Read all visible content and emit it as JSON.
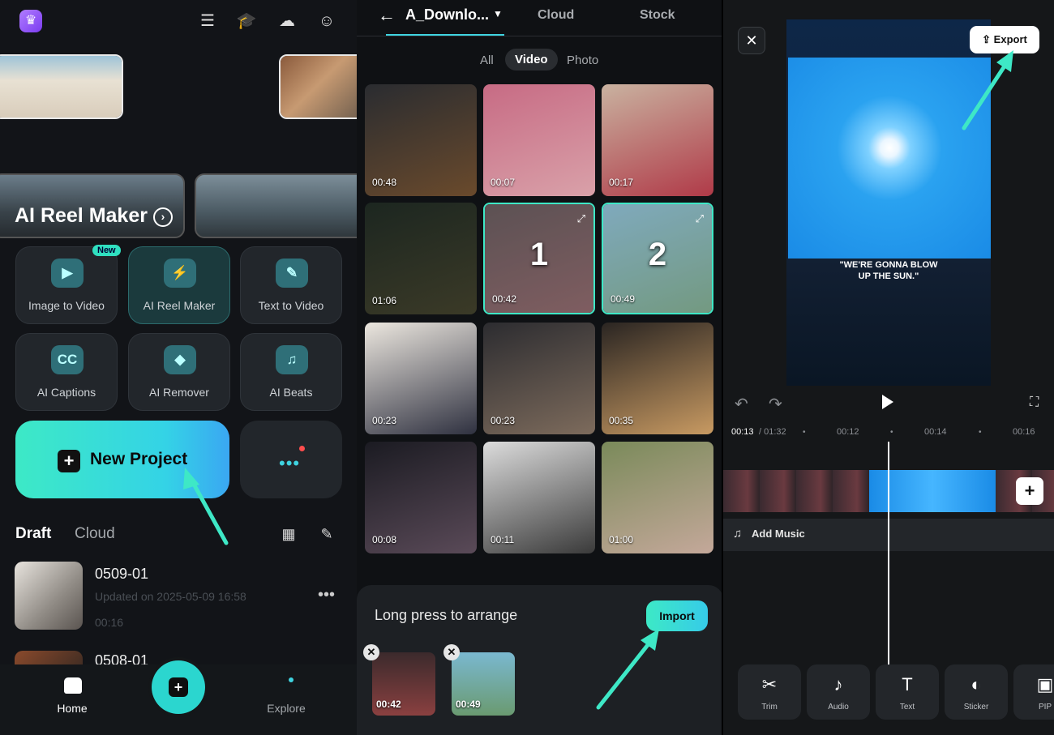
{
  "home": {
    "reel_title": "AI Reel Maker",
    "tools": [
      {
        "label": "Image to Video",
        "icon": "image-to-video-icon",
        "badge": "New"
      },
      {
        "label": "AI Reel Maker",
        "icon": "ai-reel-icon"
      },
      {
        "label": "Text to Video",
        "icon": "text-to-video-icon"
      },
      {
        "label": "AI Captions",
        "icon": "cc-icon",
        "glyph": "CC"
      },
      {
        "label": "AI Remover",
        "icon": "eraser-icon"
      },
      {
        "label": "AI Beats",
        "icon": "beats-icon"
      }
    ],
    "new_project": "New Project",
    "tabs": {
      "draft": "Draft",
      "cloud": "Cloud"
    },
    "projects": [
      {
        "name": "0509-01",
        "updated": "Updated on 2025-05-09 16:58",
        "duration": "00:16"
      },
      {
        "name": "0508-01"
      }
    ],
    "nav": {
      "home": "Home",
      "explore": "Explore"
    }
  },
  "picker": {
    "folder": "A_Downlo...",
    "tabs": [
      "Cloud",
      "Stock"
    ],
    "filters": [
      "All",
      "Video",
      "Photo"
    ],
    "selected_filter": "Video",
    "videos": [
      {
        "duration": "00:48",
        "colors": [
          "#2a2c30",
          "#6a4a2c"
        ]
      },
      {
        "duration": "00:07",
        "colors": [
          "#c76b84",
          "#d9a1a9"
        ]
      },
      {
        "duration": "00:17",
        "colors": [
          "#c9b2a0",
          "#b03a48"
        ]
      },
      {
        "duration": "01:06",
        "colors": [
          "#1c2620",
          "#3b3a27"
        ]
      },
      {
        "duration": "00:42",
        "colors": [
          "#3b2a2c",
          "#6a3a3d"
        ],
        "order": "1"
      },
      {
        "duration": "00:49",
        "colors": [
          "#6aa0b8",
          "#5a8a68"
        ],
        "order": "2"
      },
      {
        "duration": "00:23",
        "colors": [
          "#ece7df",
          "#2f3140"
        ]
      },
      {
        "duration": "00:23",
        "colors": [
          "#2c2c30",
          "#7d6b5c"
        ]
      },
      {
        "duration": "00:35",
        "colors": [
          "#2a2522",
          "#c89a62"
        ]
      },
      {
        "duration": "00:08",
        "colors": [
          "#1b1b22",
          "#5a4a58"
        ]
      },
      {
        "duration": "00:11",
        "colors": [
          "#dcdcdc",
          "#3a3a3a"
        ]
      },
      {
        "duration": "01:00",
        "colors": [
          "#7a8a5a",
          "#c4a89a"
        ]
      }
    ],
    "arrange_text": "Long press to arrange",
    "import_label": "Import",
    "selected": [
      {
        "duration": "00:42",
        "colors": [
          "#3b2a2c",
          "#8a4040"
        ]
      },
      {
        "duration": "00:49",
        "colors": [
          "#7ab8d0",
          "#6a9a70"
        ]
      }
    ]
  },
  "editor": {
    "export_label": "Export",
    "caption_line1": "\"WE'RE GONNA BLOW",
    "caption_line2": "UP THE SUN.\"",
    "timecode_current": "00:13",
    "timecode_total": "/ 01:32",
    "ticks": [
      "00:12",
      "00:14",
      "00:16"
    ],
    "add_music": "Add Music",
    "toolbar": [
      {
        "label": "Trim",
        "icon": "scissors-icon",
        "glyph": "✂"
      },
      {
        "label": "Audio",
        "icon": "music-note-icon",
        "glyph": "♪"
      },
      {
        "label": "Text",
        "icon": "text-icon",
        "glyph": "T"
      },
      {
        "label": "Sticker",
        "icon": "sticker-icon",
        "glyph": "◐"
      },
      {
        "label": "PIP",
        "icon": "pip-icon",
        "glyph": "▣"
      }
    ]
  },
  "colors": {
    "accent": "#3ee8c6",
    "accent2": "#36cbe8",
    "panel": "#121418"
  }
}
